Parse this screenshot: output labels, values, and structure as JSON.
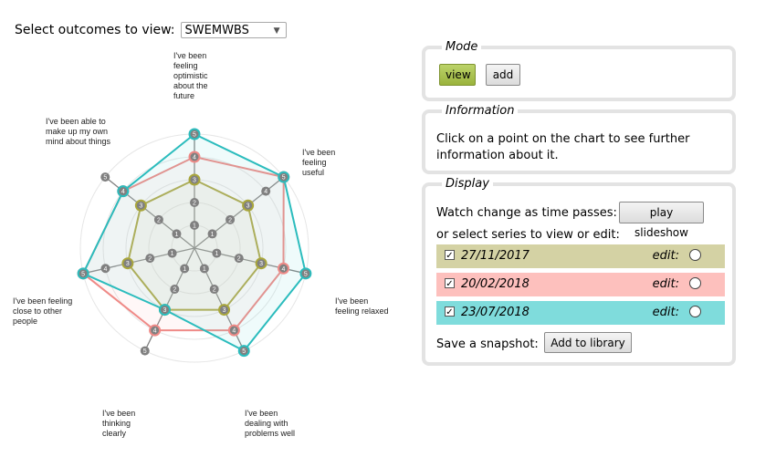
{
  "header": {
    "select_label": "Select outcomes to view:",
    "selected_outcome": "SWEMWBS"
  },
  "mode_panel": {
    "legend": "Mode",
    "view_label": "view",
    "add_label": "add"
  },
  "info_panel": {
    "legend": "Information",
    "text": "Click on a point on the chart to see further information about it."
  },
  "display_panel": {
    "legend": "Display",
    "watch_text": "Watch change as time passes:",
    "play_label": "play slideshow",
    "select_text": "or select series to view or edit:",
    "edit_label": "edit:",
    "snapshot_text": "Save a snapshot:",
    "library_label": "Add to library"
  },
  "chart_data": {
    "type": "radar",
    "axes": [
      "I've been feeling optimistic about the future",
      "I've been feeling useful",
      "I've been feeling relaxed",
      "I've been dealing with problems well",
      "I've been thinking clearly",
      "I've been feeling close to other people",
      "I've been able to make up my own mind about things"
    ],
    "scale": [
      1,
      2,
      3,
      4,
      5
    ],
    "series": [
      {
        "name": "27/11/2017",
        "color": "#a9a63c",
        "fill": "#d4d2a4",
        "values": [
          3,
          3,
          3,
          3,
          3,
          3,
          3
        ]
      },
      {
        "name": "20/02/2018",
        "color": "#ef8a87",
        "fill": "#fdc0bd",
        "values": [
          4,
          5,
          4,
          4,
          4,
          5,
          4
        ]
      },
      {
        "name": "23/07/2018",
        "color": "#2bbcbd",
        "fill": "#7fdcdc",
        "values": [
          5,
          5,
          5,
          5,
          3,
          5,
          4
        ]
      }
    ],
    "grid_color": "#e6e6e6",
    "node_color": "#808080"
  }
}
